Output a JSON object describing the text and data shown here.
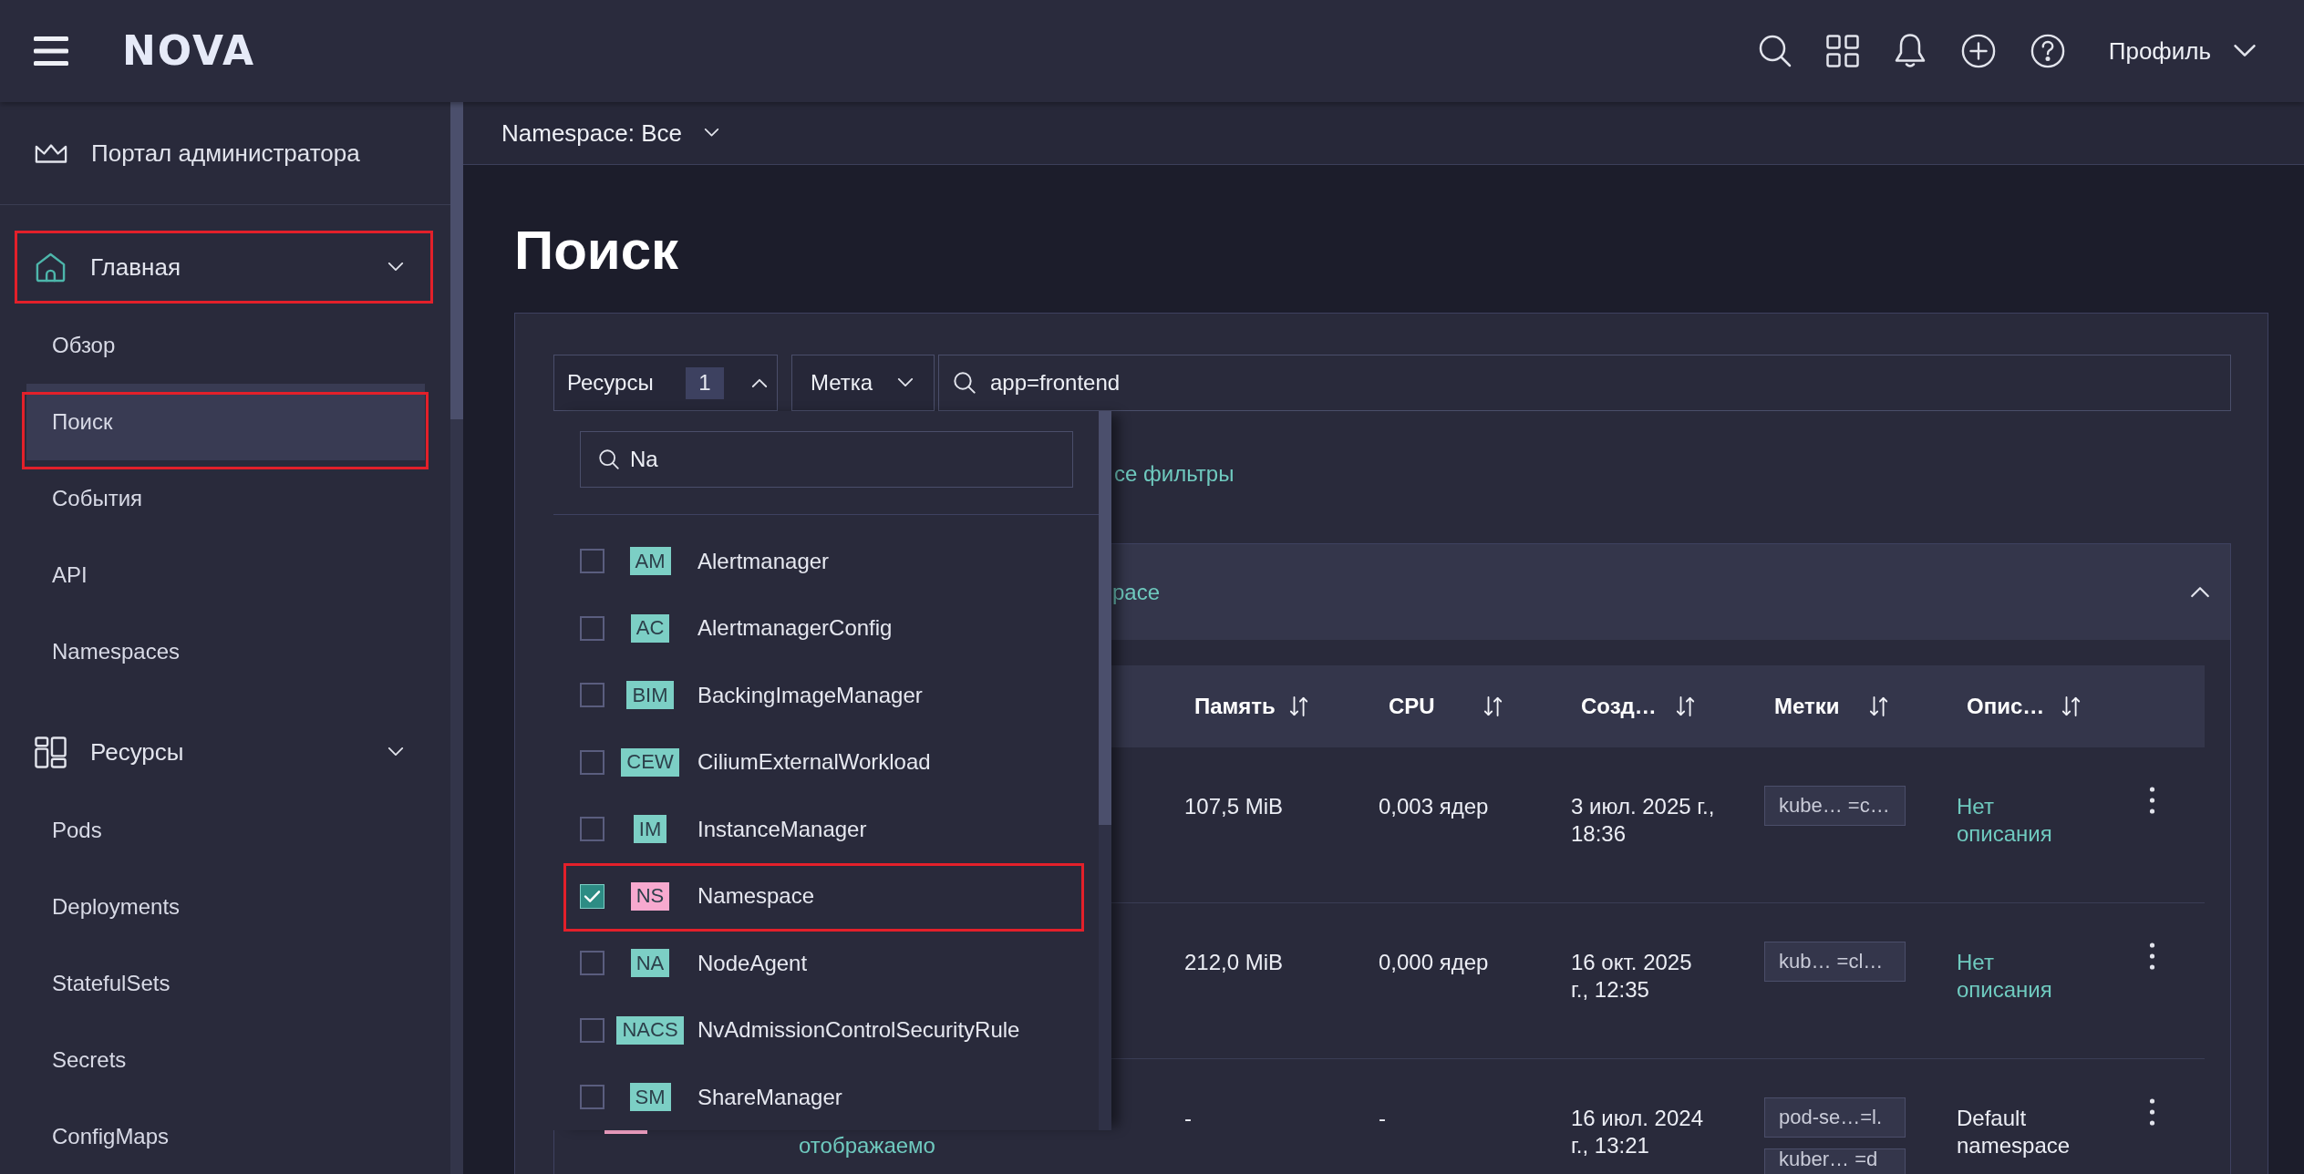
{
  "header": {
    "logo": "NOVA",
    "profile": "Профиль"
  },
  "sidebar": {
    "portal": "Портал администратора",
    "sections": [
      {
        "title": "Главная",
        "expanded": true,
        "highlighted": true,
        "items": [
          {
            "label": "Обзор",
            "selected": false,
            "highlighted": false
          },
          {
            "label": "Поиск",
            "selected": true,
            "highlighted": true
          },
          {
            "label": "События",
            "selected": false,
            "highlighted": false
          },
          {
            "label": "API",
            "selected": false,
            "highlighted": false
          },
          {
            "label": "Namespaces",
            "selected": false,
            "highlighted": false
          }
        ]
      },
      {
        "title": "Ресурсы",
        "expanded": true,
        "highlighted": false,
        "items": [
          {
            "label": "Pods",
            "selected": false,
            "highlighted": false
          },
          {
            "label": "Deployments",
            "selected": false,
            "highlighted": false
          },
          {
            "label": "StatefulSets",
            "selected": false,
            "highlighted": false
          },
          {
            "label": "Secrets",
            "selected": false,
            "highlighted": false
          },
          {
            "label": "ConfigMaps",
            "selected": false,
            "highlighted": false
          }
        ]
      }
    ]
  },
  "namespace_bar": {
    "label": "Namespace: Все"
  },
  "page": {
    "title": "Поиск"
  },
  "filters": {
    "resources": {
      "label": "Ресурсы",
      "count": "1",
      "expanded": true
    },
    "label_filter": {
      "label": "Метка",
      "expanded": false
    },
    "search": {
      "value": "app=frontend"
    },
    "clear_link": "се фильтры"
  },
  "resource_dropdown": {
    "search": {
      "value": "Na"
    },
    "options": [
      {
        "abbr": "AM",
        "name": "Alertmanager",
        "color": "#7ccfc5",
        "checked": false,
        "highlighted": false
      },
      {
        "abbr": "AC",
        "name": "AlertmanagerConfig",
        "color": "#7ccfc5",
        "checked": false,
        "highlighted": false
      },
      {
        "abbr": "BIM",
        "name": "BackingImageManager",
        "color": "#7ccfc5",
        "checked": false,
        "highlighted": false
      },
      {
        "abbr": "CEW",
        "name": "CiliumExternalWorkload",
        "color": "#7ccfc5",
        "checked": false,
        "highlighted": false
      },
      {
        "abbr": "IM",
        "name": "InstanceManager",
        "color": "#7ccfc5",
        "checked": false,
        "highlighted": false
      },
      {
        "abbr": "NS",
        "name": "Namespace",
        "color": "#f7a9cf",
        "checked": true,
        "highlighted": true
      },
      {
        "abbr": "NA",
        "name": "NodeAgent",
        "color": "#7ccfc5",
        "checked": false,
        "highlighted": false
      },
      {
        "abbr": "NACS",
        "name": "NvAdmissionControlSecurityRule",
        "color": "#7ccfc5",
        "checked": false,
        "highlighted": false
      },
      {
        "abbr": "SM",
        "name": "ShareManager",
        "color": "#7ccfc5",
        "checked": false,
        "highlighted": false
      }
    ]
  },
  "results": {
    "title": "pace",
    "expanded": true,
    "columns": [
      {
        "label": "Память"
      },
      {
        "label": "CPU"
      },
      {
        "label": "Созд…"
      },
      {
        "label": "Метки"
      },
      {
        "label": "Опис…"
      }
    ],
    "rows": [
      {
        "memory": "107,5 MiB",
        "cpu": "0,003 ядер",
        "created": "3 июл. 2025 г., 18:36",
        "labels": [
          "kube… =c…"
        ],
        "description": {
          "kind": "empty",
          "text": "Нет описания"
        }
      },
      {
        "memory": "212,0 MiB",
        "cpu": "0,000 ядер",
        "created": "16 окт. 2025 г., 12:35",
        "labels": [
          "kub… =cl…"
        ],
        "description": {
          "kind": "empty",
          "text": "Нет описания"
        }
      },
      {
        "name": {
          "color": "#f5a3c7",
          "text": "отображаемо"
        },
        "memory": "-",
        "cpu": "-",
        "created": "16 июл. 2024 г., 13:21",
        "labels": [
          "pod-se…=l.",
          "kuber… =d"
        ],
        "description": {
          "kind": "text",
          "text": "Default namespace"
        }
      }
    ]
  }
}
